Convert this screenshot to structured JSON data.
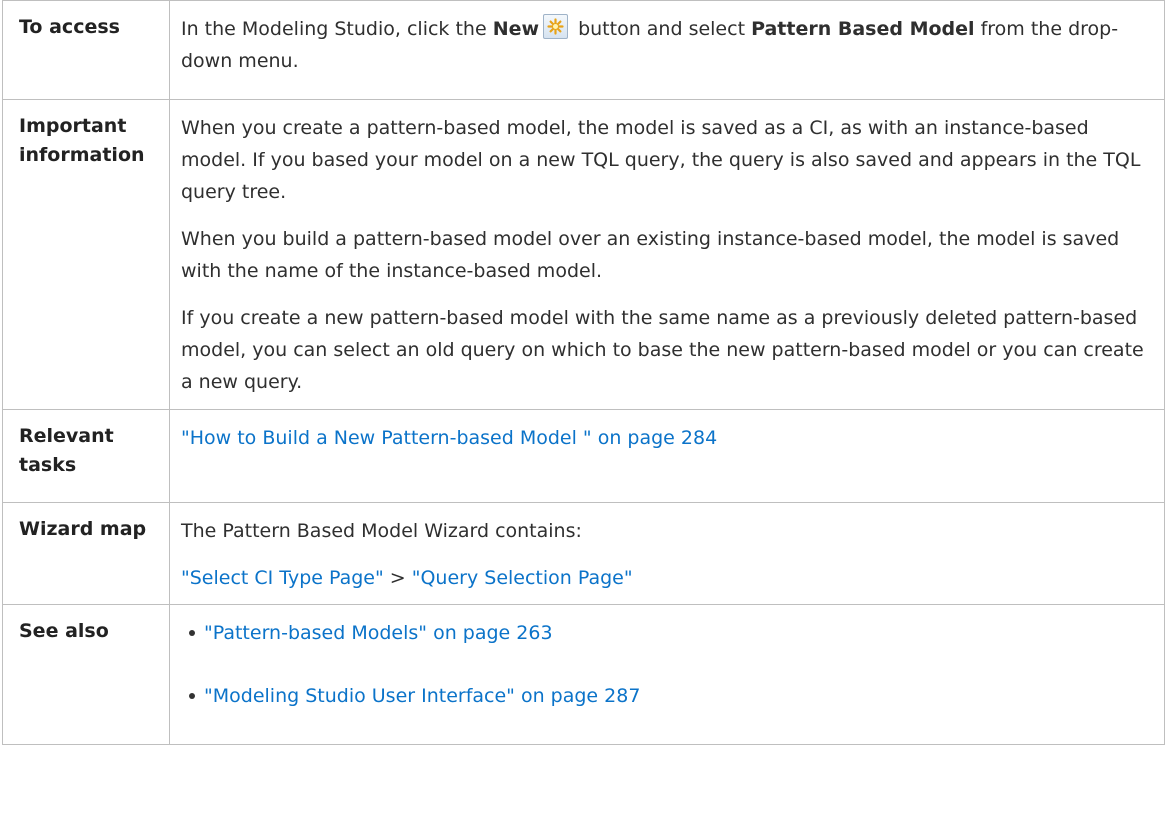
{
  "rows": [
    {
      "label": "To access",
      "content": {
        "part1": "In the Modeling Studio, click the ",
        "new_bold": "New",
        "new_icon": "new-star-icon",
        "part2": " button and select ",
        "menu_bold": "Pattern Based Model",
        "part3": " from the drop-down menu."
      }
    },
    {
      "label": "Important information",
      "paragraphs": [
        "When you create a pattern-based model, the model is saved as a CI, as with an instance-based model. If you based your model on a new TQL query, the query is also saved and appears in the TQL query tree.",
        "When you build a pattern-based model over an existing instance-based model, the model is saved with the name of the instance-based model.",
        "If you create a new pattern-based model with the same name as a previously deleted pattern-based model, you can select an old query on which to base the new pattern-based model or you can create a new query."
      ]
    },
    {
      "label": "Relevant tasks",
      "link": "\"How to Build a New Pattern-based Model \" on page 284"
    },
    {
      "label": "Wizard map",
      "intro": "The Pattern Based Model Wizard contains:",
      "link1": "\"Select CI Type Page\"",
      "separator": " > ",
      "link2": "\"Query Selection Page\""
    },
    {
      "label": "See also",
      "links": [
        "\"Pattern-based Models\" on page 263",
        "\"Modeling Studio User Interface\" on page 287"
      ]
    }
  ],
  "colors": {
    "link": "#0b73c9",
    "border": "#bfbfbf",
    "text": "#2f2f2f"
  }
}
